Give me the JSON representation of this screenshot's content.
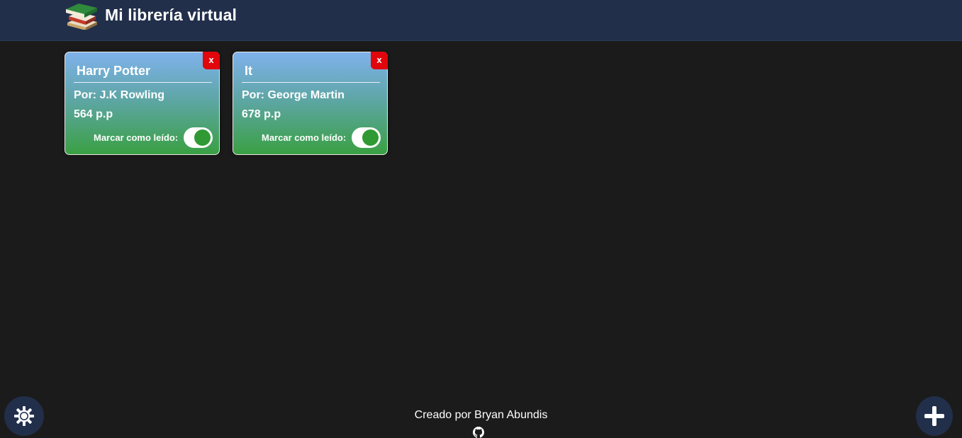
{
  "header": {
    "title": "Mi librería virtual",
    "logo_icon": "books-stack-icon"
  },
  "books": [
    {
      "title": "Harry Potter",
      "author": "Por: J.K Rowling",
      "pages": "564 p.p",
      "read_label": "Marcar como leído:",
      "read": true,
      "delete_label": "x"
    },
    {
      "title": "It",
      "author": "Por: George Martin",
      "pages": "678 p.p",
      "read_label": "Marcar como leído:",
      "read": true,
      "delete_label": "x"
    }
  ],
  "footer": {
    "credit": "Creado por Bryan Abundis",
    "github_icon": "github-icon"
  },
  "actions": {
    "theme_icon": "sun-gear-icon",
    "add_icon": "plus-icon"
  },
  "colors": {
    "header_bg": "#212f4a",
    "page_bg": "#1b1b1b",
    "card_gradient_top": "#7fb2ec",
    "card_gradient_bottom": "#3aa043",
    "delete_red": "#e0060b",
    "toggle_on": "#2f9a33"
  }
}
